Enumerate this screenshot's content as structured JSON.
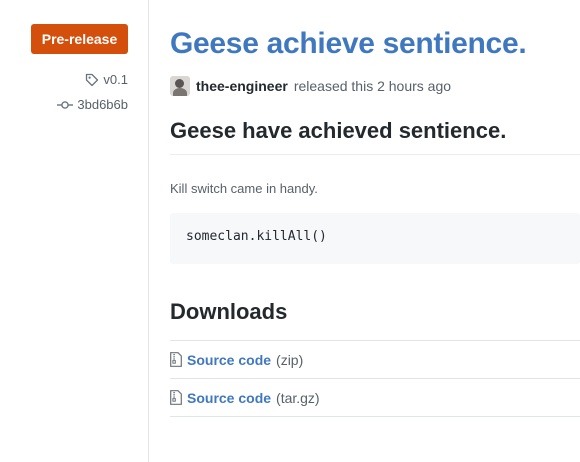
{
  "sidebar": {
    "badge_label": "Pre-release",
    "tag": "v0.1",
    "commit": "3bd6b6b"
  },
  "release": {
    "title": "Geese achieve sentience.",
    "author": "thee-engineer",
    "released_text": "released this 2 hours ago",
    "heading": "Geese have achieved sentience.",
    "description": "Kill switch came in handy.",
    "code": "someclan.killAll()"
  },
  "downloads": {
    "heading": "Downloads",
    "items": [
      {
        "label": "Source code",
        "ext": "(zip)"
      },
      {
        "label": "Source code",
        "ext": "(tar.gz)"
      }
    ]
  },
  "colors": {
    "badge": "#d44f0c",
    "link": "#4078c0",
    "muted": "#586069"
  },
  "icons": [
    "tag-icon",
    "commit-icon",
    "file-zip-icon"
  ]
}
